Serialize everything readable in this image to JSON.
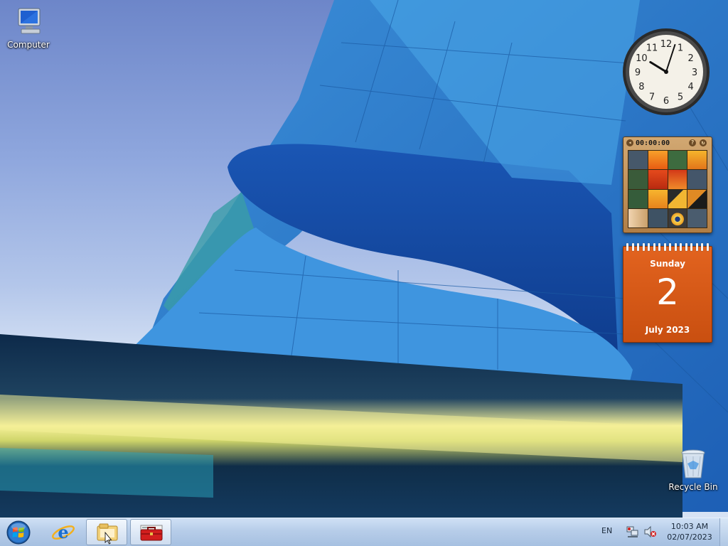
{
  "desktop": {
    "icons": [
      {
        "label": "Computer",
        "icon": "computer-icon"
      },
      {
        "label": "Recycle Bin",
        "icon": "recycle-bin-icon"
      }
    ]
  },
  "gadgets": {
    "clock": {
      "numerals": [
        "12",
        "1",
        "2",
        "3",
        "4",
        "5",
        "6",
        "7",
        "8",
        "9",
        "10",
        "11"
      ],
      "time": "10:03"
    },
    "puzzle": {
      "timer": "00:00:00"
    },
    "calendar": {
      "weekday": "Sunday",
      "day": "2",
      "month_year": "July 2023",
      "color": "#d9581a"
    }
  },
  "taskbar": {
    "pinned": [
      {
        "name": "start-button",
        "icon": "windows-logo-icon"
      },
      {
        "name": "internet-explorer",
        "icon": "ie-icon"
      },
      {
        "name": "windows-explorer",
        "icon": "folder-icon",
        "active": true
      },
      {
        "name": "toolbox-app",
        "icon": "toolbox-icon"
      }
    ],
    "tray": {
      "language": "EN",
      "icons": [
        "network-icon",
        "volume-muted-icon"
      ],
      "time": "10:03 AM",
      "date": "02/07/2023"
    }
  }
}
